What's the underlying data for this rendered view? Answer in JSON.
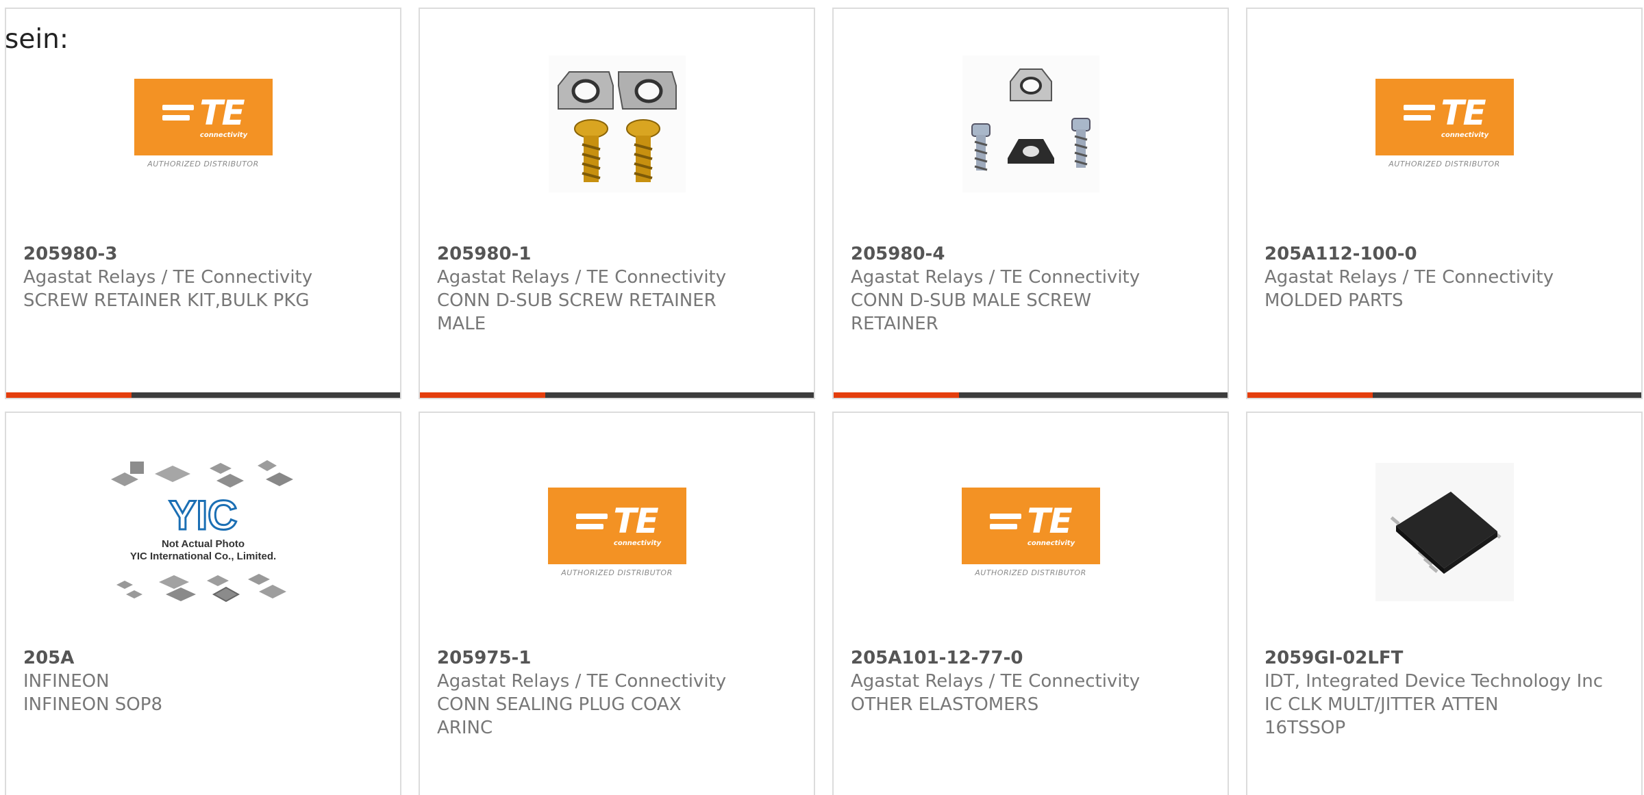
{
  "intro_text": "sein:",
  "te_logo": {
    "brand": "TE",
    "sub": "connectivity",
    "distributor": "AUTHORIZED DISTRIBUTOR",
    "brand_color": "#f39224"
  },
  "yic_placeholder": {
    "logo": "YIC",
    "line1": "Not Actual Photo",
    "line2": "YIC International Co., Limited."
  },
  "colors": {
    "accent": "#e43e0d",
    "bar": "#3c3c3c"
  },
  "products": [
    {
      "part": "205980-3",
      "maker": "Agastat Relays / TE Connectivity",
      "desc": "SCREW RETAINER KIT,BULK PKG",
      "image": "te-logo"
    },
    {
      "part": "205980-1",
      "maker": "Agastat Relays / TE Connectivity",
      "desc": "CONN D-SUB SCREW RETAINER MALE",
      "image": "screw-retainer-photo"
    },
    {
      "part": "205980-4",
      "maker": "Agastat Relays / TE Connectivity",
      "desc": "CONN D-SUB MALE SCREW RETAINER",
      "image": "screw-retainer-photo"
    },
    {
      "part": "205A112-100-0",
      "maker": "Agastat Relays / TE Connectivity",
      "desc": "MOLDED PARTS",
      "image": "te-logo"
    },
    {
      "part": "205A",
      "maker": "INFINEON",
      "desc": "INFINEON SOP8",
      "image": "yic-placeholder"
    },
    {
      "part": "205975-1",
      "maker": "Agastat Relays / TE Connectivity",
      "desc": "CONN SEALING PLUG COAX ARINC",
      "image": "te-logo"
    },
    {
      "part": "205A101-12-77-0",
      "maker": "Agastat Relays / TE Connectivity",
      "desc": "OTHER ELASTOMERS",
      "image": "te-logo"
    },
    {
      "part": "2059GI-02LFT",
      "maker": "IDT, Integrated Device Technology Inc",
      "desc": "IC CLK MULT/JITTER ATTEN 16TSSOP",
      "image": "ic-chip-photo"
    }
  ]
}
